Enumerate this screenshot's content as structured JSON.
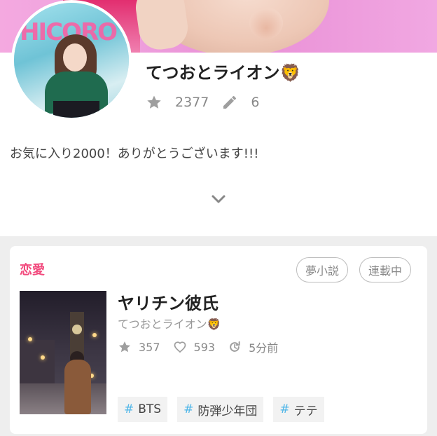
{
  "profile": {
    "username": "てつおとライオン🦁",
    "stats": {
      "favorites": "2377",
      "works": "6"
    },
    "bio": "お気に入り2000！ありがとうございます!!!",
    "icons": {
      "favorites": "star-icon",
      "works": "pencil-icon",
      "expand": "chevron-down-icon"
    }
  },
  "story_card": {
    "genre": "恋愛",
    "labels": [
      "夢小説",
      "連載中"
    ],
    "title": "ヤリチン彼氏",
    "author": "てつおとライオン🦁",
    "stats": {
      "stars": "357",
      "likes": "593",
      "updated": "5分前"
    },
    "hashtags": [
      "BTS",
      "防弾少年団",
      "テテ"
    ],
    "hash_symbol": "#"
  },
  "colors": {
    "accent_pink": "#f24a7d",
    "hashtag_blue": "#4fb6e8",
    "icon_gray": "#9e9e9e"
  }
}
